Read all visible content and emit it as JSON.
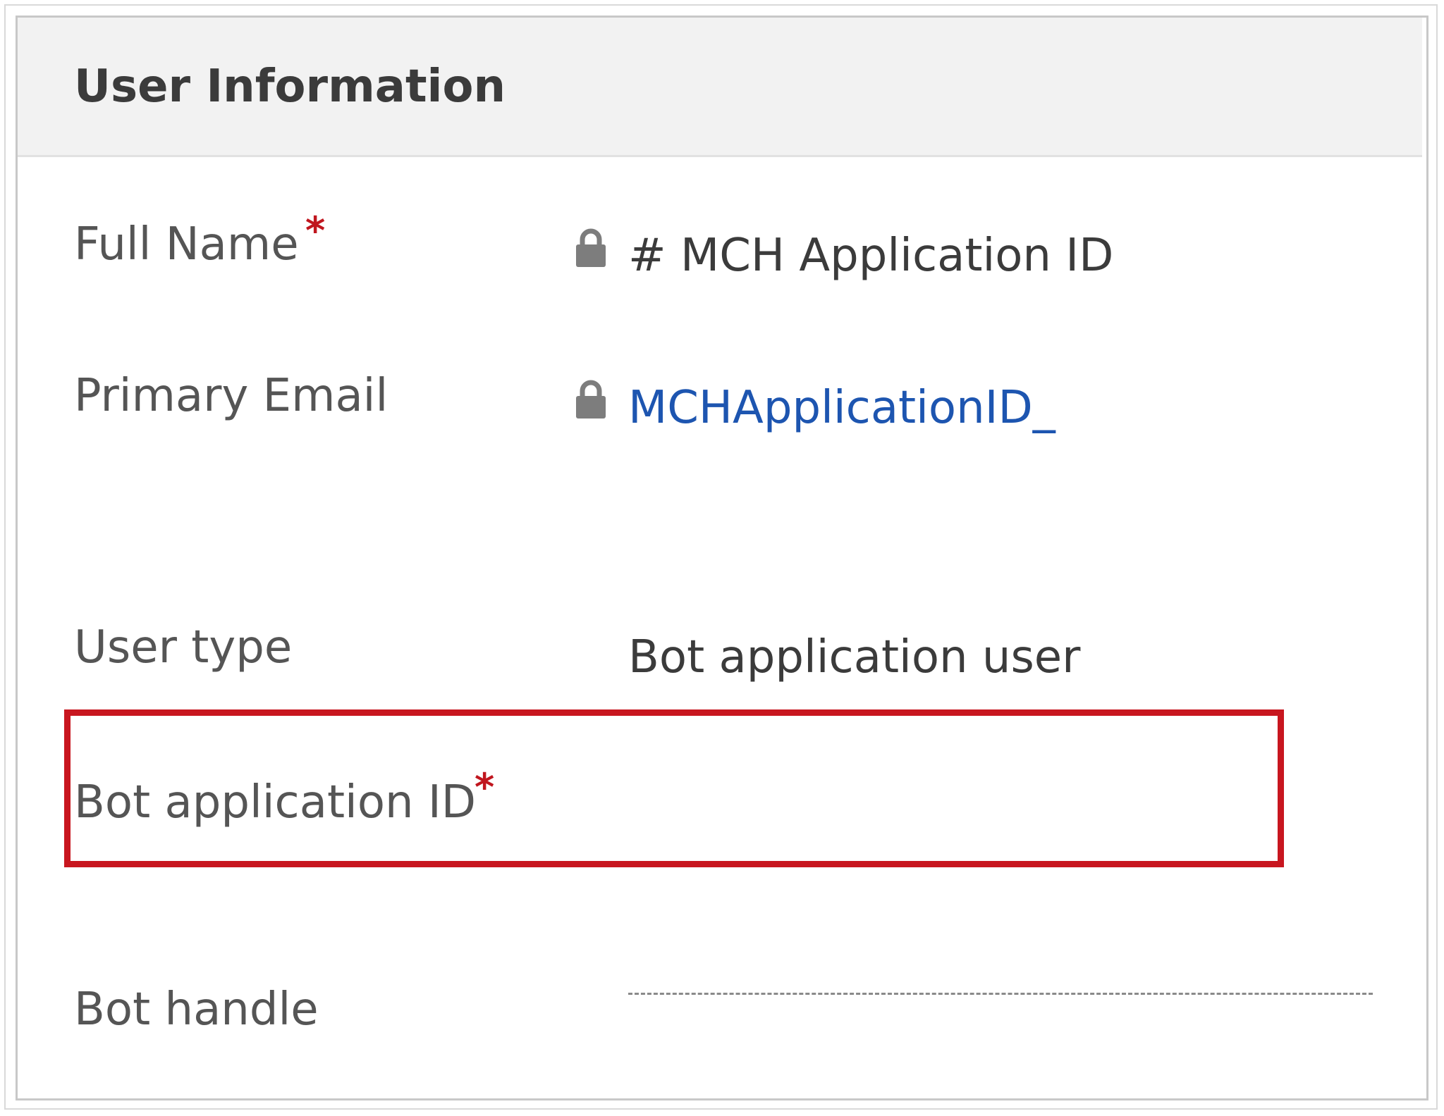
{
  "section": {
    "title": "User Information"
  },
  "fields": {
    "full_name": {
      "label": "Full Name",
      "required_mark": "*",
      "value": "# MCH Application ID",
      "locked": true
    },
    "primary_email": {
      "label": "Primary Email",
      "value": "MCHApplicationID_",
      "locked": true
    },
    "user_type": {
      "label": "User type",
      "value": "Bot application user"
    },
    "bot_application_id": {
      "label": "Bot application ID",
      "required_mark": "*",
      "value": ""
    },
    "bot_handle": {
      "label": "Bot handle",
      "value": ""
    }
  },
  "colors": {
    "required": "#c0161e",
    "link": "#1d55b0",
    "highlight_border": "#c8161f",
    "header_bg": "#f2f2f2",
    "lock_icon": "#7d7d7d"
  },
  "icons": {
    "full_name_lock": "lock-icon",
    "primary_email_lock": "lock-icon"
  }
}
